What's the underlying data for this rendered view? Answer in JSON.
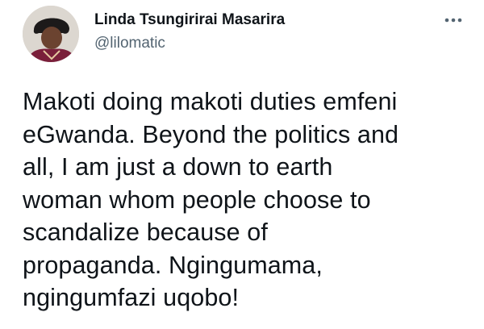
{
  "tweet": {
    "author": {
      "display_name": "Linda Tsungirirai Masarira",
      "handle": "@lilomatic",
      "avatar_icon": "profile-photo"
    },
    "more_icon": "more-options-icon",
    "text": "Makoti doing makoti duties emfeni\neGwanda. Beyond the politics and\nall, I am just a down to earth\nwoman whom people choose to\nscandalize because of\npropaganda. Ngingumama,\nngingumfazi uqobo!"
  },
  "colors": {
    "text_primary": "#0f1419",
    "text_secondary": "#536471",
    "background": "#ffffff"
  }
}
